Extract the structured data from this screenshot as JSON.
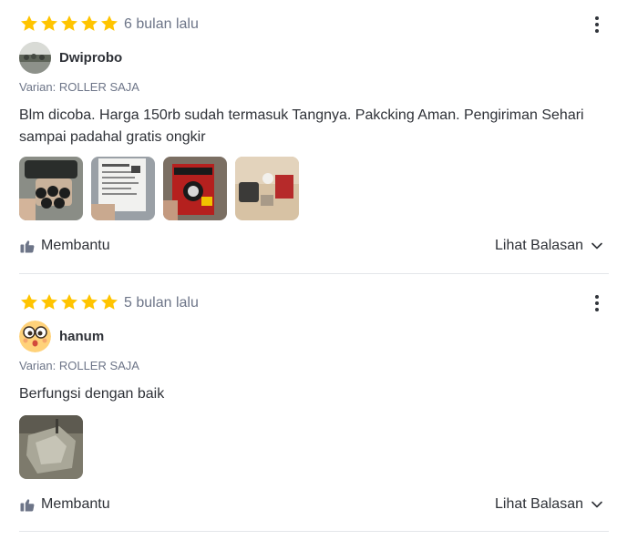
{
  "reviews": [
    {
      "rating": 5,
      "time": "6 bulan lalu",
      "username": "Dwiprobo",
      "variant": "Varian: ROLLER SAJA",
      "text": "Blm dicoba. Harga 150rb sudah termasuk Tangnya. Pakcking Aman. Pengiriman Sehari sampai padahal gratis ongkir",
      "photo_count": 4,
      "helpful_label": "Membantu",
      "replies_label": "Lihat Balasan"
    },
    {
      "rating": 5,
      "time": "5 bulan lalu",
      "username": "hanum",
      "variant": "Varian: ROLLER SAJA",
      "text": "Berfungsi dengan baik",
      "photo_count": 1,
      "helpful_label": "Membantu",
      "replies_label": "Lihat Balasan"
    }
  ],
  "colors": {
    "star": "#ffc400",
    "text": "#2e3137",
    "muted": "#6d7588",
    "divider": "#e4e6ea"
  },
  "icons": {
    "star": "star-icon",
    "more": "more-vertical-icon",
    "helpful": "thumbs-up-icon",
    "expand": "chevron-down-icon"
  }
}
